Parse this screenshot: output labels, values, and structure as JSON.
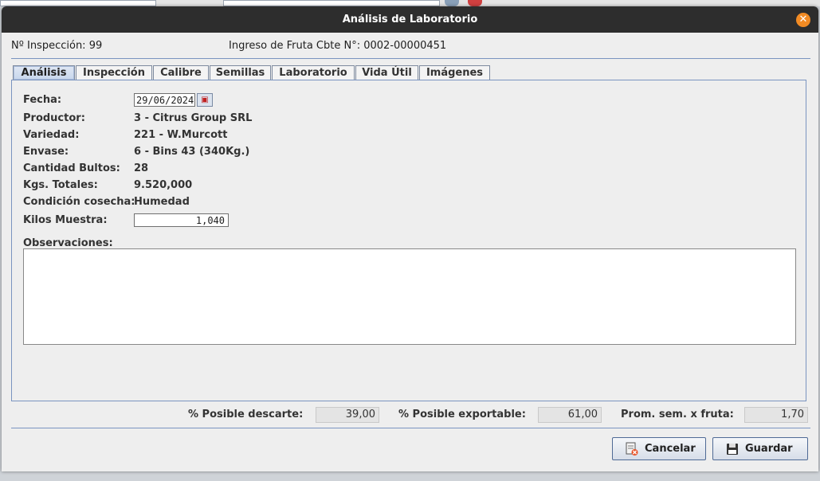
{
  "window": {
    "title": "Análisis de Laboratorio"
  },
  "header": {
    "inspeccion": "Nº Inspección: 99",
    "ingreso": "Ingreso de Fruta Cbte N°: 0002-00000451"
  },
  "tabs": [
    "Análisis",
    "Inspección",
    "Calibre",
    "Semillas",
    "Laboratorio",
    "Vida Útil",
    "Imágenes"
  ],
  "active_tab": "Análisis",
  "form": {
    "fecha_label": "Fecha:",
    "fecha_value": "29/06/2024",
    "productor_label": "Productor:",
    "productor_value": "3 - Citrus Group SRL",
    "variedad_label": "Variedad:",
    "variedad_value": "221 - W.Murcott",
    "envase_label": "Envase:",
    "envase_value": "6 - Bins 43 (340Kg.)",
    "bultos_label": "Cantidad Bultos:",
    "bultos_value": "28",
    "kgs_label": "Kgs. Totales:",
    "kgs_value": "9.520,000",
    "condicion_label": "Condición cosecha:",
    "condicion_value": "Humedad",
    "kilos_label": "Kilos Muestra:",
    "kilos_value": "1,040",
    "obs_label": "Observaciones:",
    "obs_value": ""
  },
  "stats": {
    "descarte_label": "% Posible descarte:",
    "descarte_value": "39,00",
    "exportable_label": "% Posible exportable:",
    "exportable_value": "61,00",
    "prom_label": "Prom. sem. x fruta:",
    "prom_value": "1,70"
  },
  "buttons": {
    "cancel": "Cancelar",
    "save": "Guardar"
  },
  "colors": {
    "titlebar": "#2d2d2d",
    "close": "#f28b24",
    "accent": "#7a94c0"
  }
}
